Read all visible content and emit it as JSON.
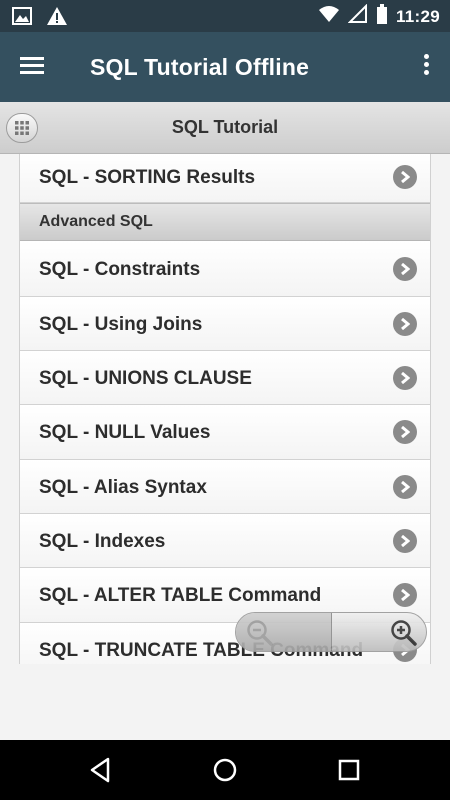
{
  "status_bar": {
    "time": "11:29"
  },
  "app_bar": {
    "title": "SQL Tutorial Offline"
  },
  "sub_header": {
    "title": "SQL Tutorial"
  },
  "list": {
    "rows": [
      {
        "label": "SQL - SORTING Results"
      },
      {
        "section": "Advanced SQL"
      },
      {
        "label": "SQL - Constraints"
      },
      {
        "label": "SQL - Using Joins"
      },
      {
        "label": "SQL - UNIONS CLAUSE"
      },
      {
        "label": "SQL - NULL Values"
      },
      {
        "label": "SQL - Alias Syntax"
      },
      {
        "label": "SQL - Indexes"
      },
      {
        "label": "SQL - ALTER TABLE Command"
      },
      {
        "label": "SQL - TRUNCATE TABLE Command"
      }
    ]
  },
  "icons": {
    "status_left": [
      "image-icon",
      "warning-icon"
    ],
    "status_right": [
      "wifi-icon",
      "signal-icon",
      "battery-icon"
    ],
    "row_arrow": "chevron-right-icon",
    "zoom": [
      "zoom-out-icon",
      "zoom-in-icon"
    ],
    "nav": [
      "back-icon",
      "home-icon",
      "recents-icon"
    ]
  },
  "colors": {
    "status_bar": "#2a3c47",
    "app_bar": "#34505f",
    "chevron": "#8a8a8a"
  }
}
